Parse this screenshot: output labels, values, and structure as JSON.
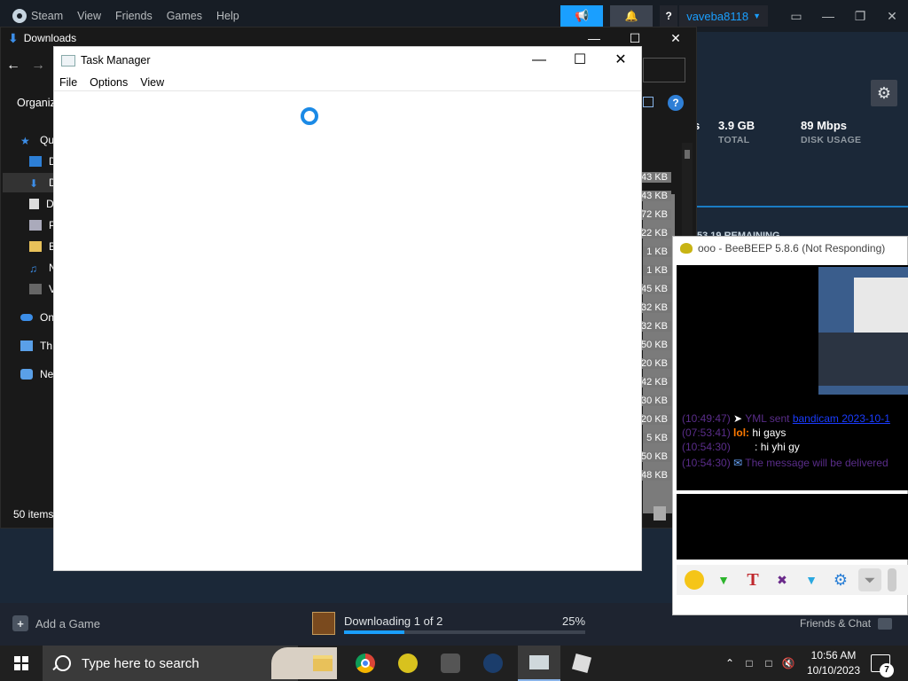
{
  "steam": {
    "menu": [
      "Steam",
      "View",
      "Friends",
      "Games",
      "Help"
    ],
    "help_label": "?",
    "username": "vaveba8118",
    "stats": {
      "fragment": "s",
      "total_value": "3.9 GB",
      "total_label": "TOTAL",
      "disk_value": "89 Mbps",
      "disk_label": "DISK USAGE"
    },
    "remaining_fragment": "53.19 REMAINING",
    "bottom": {
      "add_game": "Add a Game",
      "download_text": "Downloading 1 of 2",
      "download_pct": "25%",
      "download_progress": 25,
      "friends_chat": "Friends & Chat"
    },
    "accent": "#1a9fff"
  },
  "explorer": {
    "title": "Downloads",
    "organize": "Organiz",
    "nav_items": [
      "Qu",
      "D",
      "D",
      "D",
      "P",
      "B",
      "N",
      "V",
      "On",
      "Th",
      "Ne"
    ],
    "sizes": [
      "43 KB",
      "43 KB",
      "72 KB",
      "22 KB",
      "1 KB",
      "1 KB",
      "45 KB",
      "32 KB",
      "32 KB",
      "50 KB",
      "20 KB",
      "42 KB",
      "30 KB",
      "20 KB",
      "5 KB",
      "50 KB",
      "48 KB"
    ],
    "items_count": "50 items",
    "help_label": "?"
  },
  "taskmgr": {
    "title": "Task Manager",
    "menu": [
      "File",
      "Options",
      "View"
    ]
  },
  "beebeep": {
    "title": "ooo - BeeBEEP 5.8.6 (Not Responding)",
    "messages": [
      {
        "time": "(10:49:47)",
        "text": "YML sent",
        "link": "bandicam 2023-10-1"
      },
      {
        "time": "(07:53:41)",
        "nick": "lol:",
        "text": "hi gays"
      },
      {
        "time": "(10:54:30)",
        "nick": ":",
        "text": "hi yhi gy"
      },
      {
        "time": "(10:54:30)",
        "text": "The message will be delivered"
      }
    ]
  },
  "taskbar": {
    "search_placeholder": "Type here to search",
    "time": "10:56 AM",
    "date": "10/10/2023",
    "notification_count": "7"
  }
}
